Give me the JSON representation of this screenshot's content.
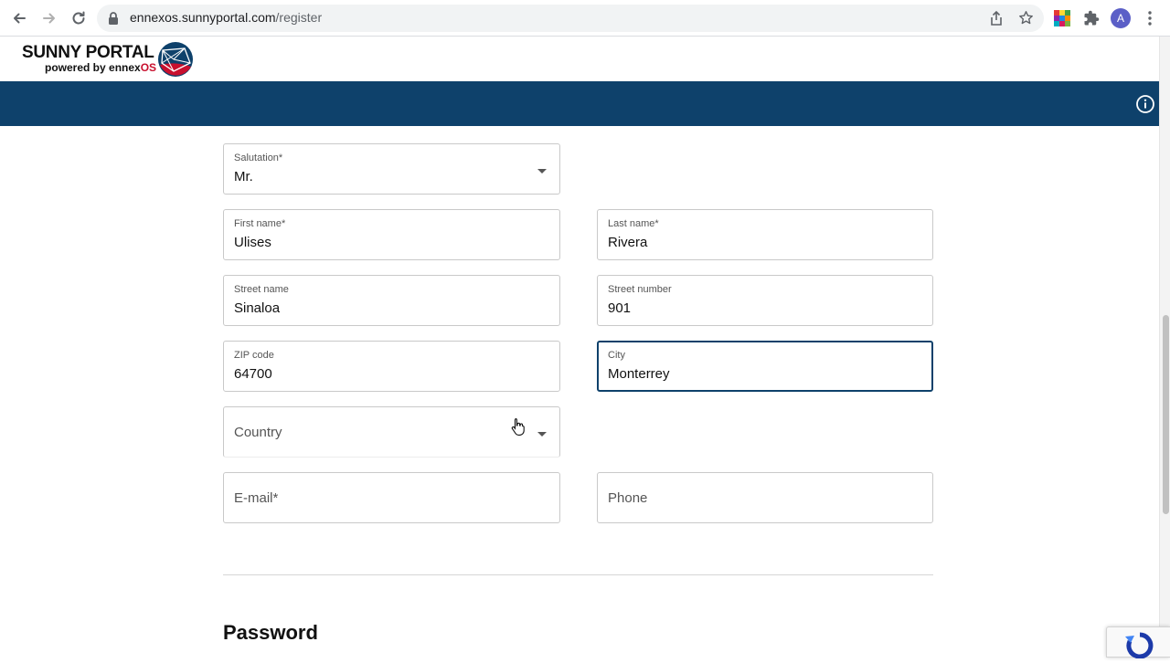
{
  "browser": {
    "url_host": "ennexos.sunnyportal.com",
    "url_path": "/register",
    "avatar_letter": "A"
  },
  "header": {
    "logo_title": "SUNNY PORTAL",
    "logo_sub_prefix": "powered by ennex",
    "logo_sub_suffix": "OS"
  },
  "form": {
    "salutation": {
      "label": "Salutation*",
      "value": "Mr."
    },
    "first_name": {
      "label": "First name*",
      "value": "Ulises"
    },
    "last_name": {
      "label": "Last name*",
      "value": "Rivera"
    },
    "street_name": {
      "label": "Street name",
      "value": "Sinaloa"
    },
    "street_number": {
      "label": "Street number",
      "value": "901"
    },
    "zip_code": {
      "label": "ZIP code",
      "value": "64700"
    },
    "city": {
      "label": "City",
      "value": "Monterrey"
    },
    "country": {
      "placeholder": "Country"
    },
    "email": {
      "placeholder": "E-mail*"
    },
    "phone": {
      "placeholder": "Phone"
    }
  },
  "sections": {
    "password_title": "Password"
  },
  "colors": {
    "brand_blue": "#0e416b",
    "brand_red": "#c8102e"
  },
  "icons": [
    "back-arrow-icon",
    "forward-arrow-icon",
    "reload-icon",
    "lock-icon",
    "share-icon",
    "star-icon",
    "puzzle-icon",
    "menu-dots-icon",
    "info-icon",
    "chevron-down-icon",
    "recaptcha-icon"
  ]
}
